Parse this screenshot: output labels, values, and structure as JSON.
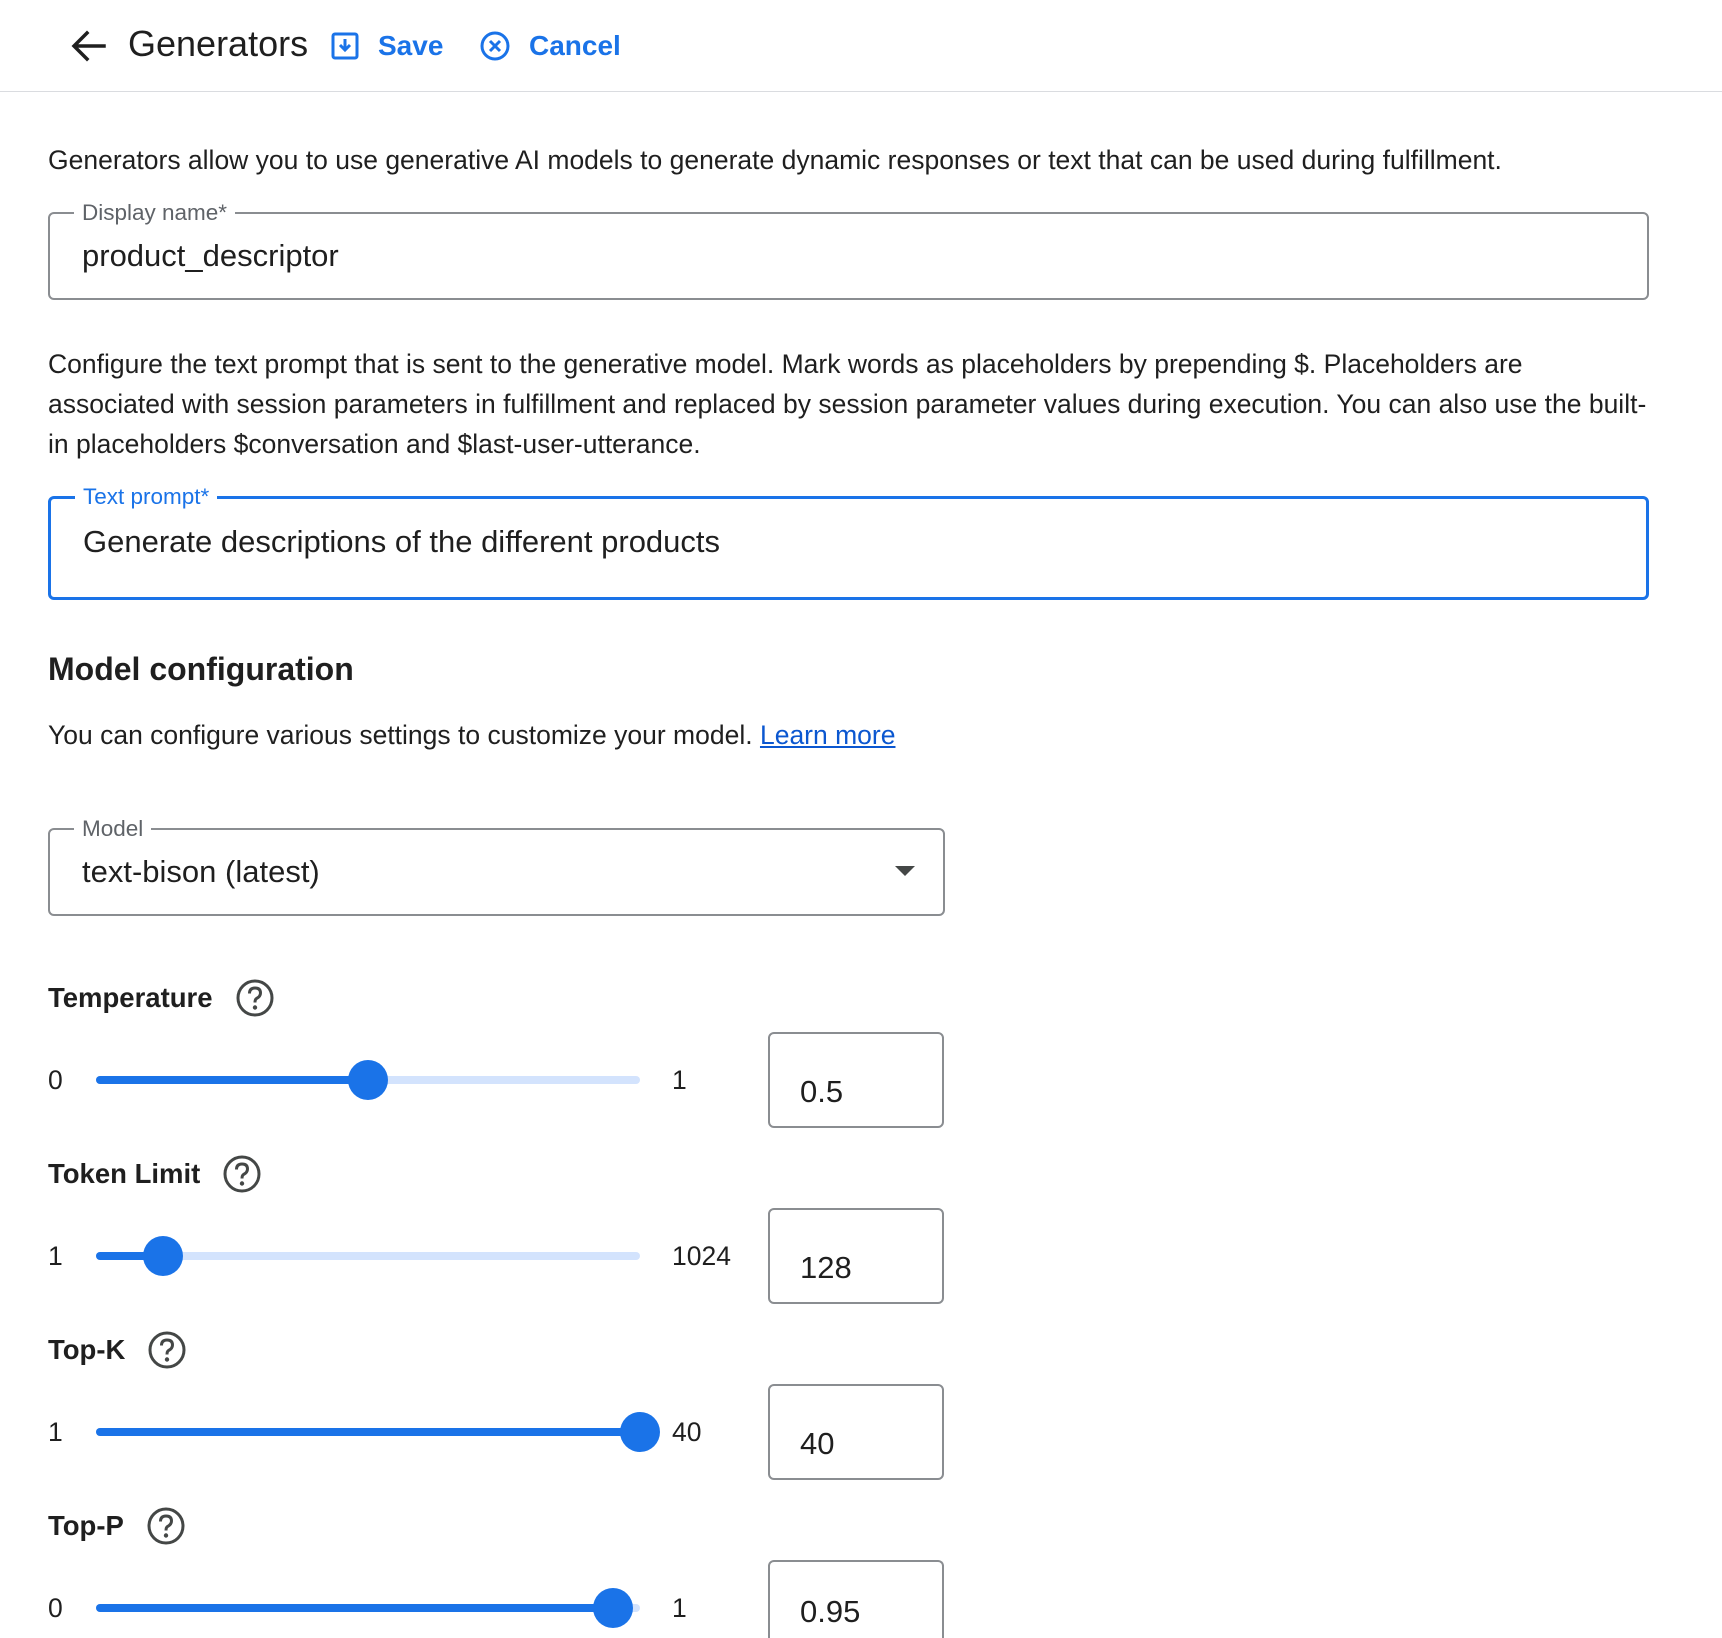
{
  "header": {
    "title": "Generators",
    "save_label": "Save",
    "cancel_label": "Cancel"
  },
  "intro_text": "Generators allow you to use generative AI models to generate dynamic responses or text that can be used during fulfillment.",
  "display_name": {
    "label": "Display name*",
    "value": "product_descriptor"
  },
  "prompt_help": "Configure the text prompt that is sent to the generative model. Mark words as placeholders by prepending $. Placeholders are associated with session parameters in fulfillment and replaced by session parameter values during execution. You can also use the built-in placeholders $conversation and $last-user-utterance.",
  "text_prompt": {
    "label": "Text prompt*",
    "value": "Generate descriptions of the different products"
  },
  "model_config": {
    "title": "Model configuration",
    "help": "You can configure various settings to customize your model.",
    "learn_more": "Learn more",
    "model_label": "Model",
    "model_value": "text-bison (latest)"
  },
  "params": [
    {
      "label": "Temperature",
      "min": "0",
      "max": "1",
      "value": "0.5",
      "fraction": 0.5
    },
    {
      "label": "Token Limit",
      "min": "1",
      "max": "1024",
      "value": "128",
      "fraction": 0.124
    },
    {
      "label": "Top-K",
      "min": "1",
      "max": "40",
      "value": "40",
      "fraction": 1.0
    },
    {
      "label": "Top-P",
      "min": "0",
      "max": "1",
      "value": "0.95",
      "fraction": 0.95
    }
  ],
  "colors": {
    "accent": "#1a73e8",
    "track_inactive": "#d3e3fd",
    "link": "#0b57d0"
  }
}
